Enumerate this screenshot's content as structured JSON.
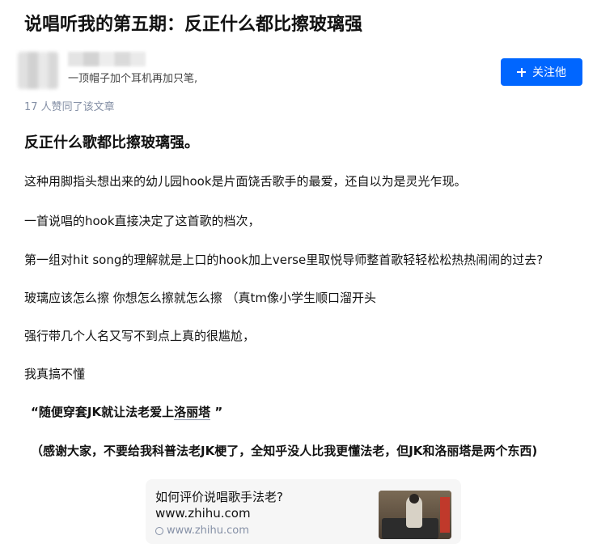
{
  "article": {
    "title": "说唱听我的第五期：反正什么都比擦玻璃强",
    "author": {
      "headline": "一顶帽子加个耳机再加只笔,"
    },
    "follow_button": {
      "label": "关注他",
      "icon": "plus-icon",
      "color": "#0066ff"
    },
    "upvote_text": "17 人赞同了该文章",
    "heading": "反正什么歌都比擦玻璃强。",
    "paragraphs": [
      "这种用脚指头想出来的幼儿园hook是片面饶舌歌手的最爱，还自以为是灵光乍现。",
      "一首说唱的hook直接决定了这首歌的档次，",
      "第一组对hit song的理解就是上口的hook加上verse里取悦导师整首歌轻轻松松热热闹闹的过去?",
      "玻璃应该怎么擦 你想怎么擦就怎么擦 （真tm像小学生顺口溜开头",
      "强行带几个人名又写不到点上真的很尴尬，",
      "我真搞不懂"
    ],
    "quote": {
      "prefix": "“随便穿套JK就让法老爱上",
      "link": "洛丽塔",
      "suffix": " ”"
    },
    "note": "（感谢大家，不要给我科普法老JK梗了，全知乎没人比我更懂法老，但JK和洛丽塔是两个东西)",
    "link_card": {
      "title": "如何评价说唱歌手法老?",
      "domain": "www.zhihu.com",
      "sub_domain": "www.zhihu.com"
    }
  }
}
